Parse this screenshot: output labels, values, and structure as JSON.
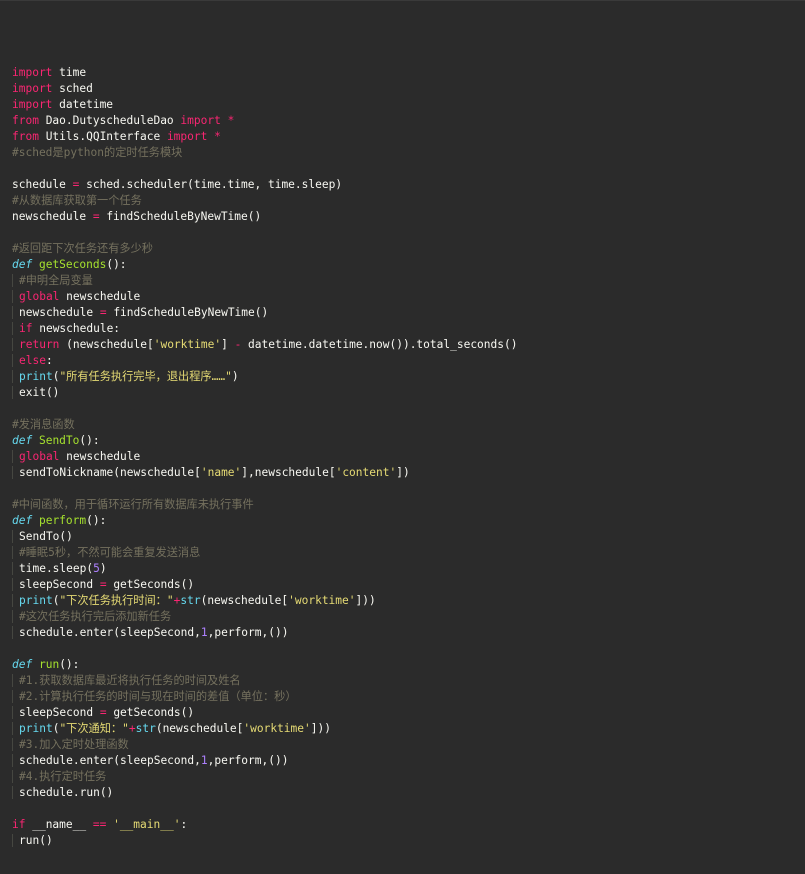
{
  "theme": {
    "background": "#2b2b2b",
    "keyword": "#f92672",
    "def_keyword": "#66d9ef",
    "function_name": "#a6e22e",
    "string": "#e6db74",
    "number": "#ae81ff",
    "comment": "#75715e",
    "text": "#f8f8f2"
  },
  "lines": [
    {
      "indent": false,
      "tokens": [
        {
          "t": "kw",
          "v": "import"
        },
        {
          "t": "txt",
          "v": " time"
        }
      ]
    },
    {
      "indent": false,
      "tokens": [
        {
          "t": "kw",
          "v": "import"
        },
        {
          "t": "txt",
          "v": " sched"
        }
      ]
    },
    {
      "indent": false,
      "tokens": [
        {
          "t": "kw",
          "v": "import"
        },
        {
          "t": "txt",
          "v": " datetime"
        }
      ]
    },
    {
      "indent": false,
      "tokens": [
        {
          "t": "kw",
          "v": "from"
        },
        {
          "t": "txt",
          "v": " Dao.DutyscheduleDao "
        },
        {
          "t": "kw",
          "v": "import"
        },
        {
          "t": "op",
          "v": " *"
        }
      ]
    },
    {
      "indent": false,
      "tokens": [
        {
          "t": "kw",
          "v": "from"
        },
        {
          "t": "txt",
          "v": " Utils.QQInterface "
        },
        {
          "t": "kw",
          "v": "import"
        },
        {
          "t": "op",
          "v": " *"
        }
      ]
    },
    {
      "indent": false,
      "tokens": [
        {
          "t": "cmt",
          "v": "#sched是python的定时任务模块"
        }
      ]
    },
    {
      "indent": false,
      "tokens": []
    },
    {
      "indent": false,
      "tokens": [
        {
          "t": "txt",
          "v": "schedule "
        },
        {
          "t": "op",
          "v": "="
        },
        {
          "t": "txt",
          "v": " sched.scheduler(time.time, time.sleep)"
        }
      ]
    },
    {
      "indent": false,
      "tokens": [
        {
          "t": "cmt",
          "v": "#从数据库获取第一个任务"
        }
      ]
    },
    {
      "indent": false,
      "tokens": [
        {
          "t": "txt",
          "v": "newschedule "
        },
        {
          "t": "op",
          "v": "="
        },
        {
          "t": "txt",
          "v": " findScheduleByNewTime()"
        }
      ]
    },
    {
      "indent": false,
      "tokens": []
    },
    {
      "indent": false,
      "tokens": [
        {
          "t": "cmt",
          "v": "#返回距下次任务还有多少秒"
        }
      ]
    },
    {
      "indent": false,
      "tokens": [
        {
          "t": "def",
          "v": "def"
        },
        {
          "t": "txt",
          "v": " "
        },
        {
          "t": "fn",
          "v": "getSeconds"
        },
        {
          "t": "txt",
          "v": "():"
        }
      ]
    },
    {
      "indent": true,
      "tokens": [
        {
          "t": "cmt",
          "v": "#申明全局变量"
        }
      ]
    },
    {
      "indent": true,
      "tokens": [
        {
          "t": "kw",
          "v": "global"
        },
        {
          "t": "txt",
          "v": " newschedule"
        }
      ]
    },
    {
      "indent": true,
      "tokens": [
        {
          "t": "txt",
          "v": "newschedule "
        },
        {
          "t": "op",
          "v": "="
        },
        {
          "t": "txt",
          "v": " findScheduleByNewTime()"
        }
      ]
    },
    {
      "indent": true,
      "tokens": [
        {
          "t": "kw",
          "v": "if"
        },
        {
          "t": "txt",
          "v": " newschedule:"
        }
      ]
    },
    {
      "indent": true,
      "tokens": [
        {
          "t": "kw",
          "v": "return"
        },
        {
          "t": "txt",
          "v": " (newschedule["
        },
        {
          "t": "str",
          "v": "'worktime'"
        },
        {
          "t": "txt",
          "v": "] "
        },
        {
          "t": "op",
          "v": "-"
        },
        {
          "t": "txt",
          "v": " datetime.datetime.now()).total_seconds()"
        }
      ]
    },
    {
      "indent": true,
      "tokens": [
        {
          "t": "kw",
          "v": "else"
        },
        {
          "t": "txt",
          "v": ":"
        }
      ]
    },
    {
      "indent": true,
      "tokens": [
        {
          "t": "bi",
          "v": "print"
        },
        {
          "t": "txt",
          "v": "("
        },
        {
          "t": "str",
          "v": "\"所有任务执行完毕，退出程序……\""
        },
        {
          "t": "txt",
          "v": ")"
        }
      ]
    },
    {
      "indent": true,
      "tokens": [
        {
          "t": "txt",
          "v": "exit()"
        }
      ]
    },
    {
      "indent": false,
      "tokens": []
    },
    {
      "indent": false,
      "tokens": [
        {
          "t": "cmt",
          "v": "#发消息函数"
        }
      ]
    },
    {
      "indent": false,
      "tokens": [
        {
          "t": "def",
          "v": "def"
        },
        {
          "t": "txt",
          "v": " "
        },
        {
          "t": "fn",
          "v": "SendTo"
        },
        {
          "t": "txt",
          "v": "():"
        }
      ]
    },
    {
      "indent": true,
      "tokens": [
        {
          "t": "kw",
          "v": "global"
        },
        {
          "t": "txt",
          "v": " newschedule"
        }
      ]
    },
    {
      "indent": true,
      "tokens": [
        {
          "t": "txt",
          "v": "sendToNickname(newschedule["
        },
        {
          "t": "str",
          "v": "'name'"
        },
        {
          "t": "txt",
          "v": "],newschedule["
        },
        {
          "t": "str",
          "v": "'content'"
        },
        {
          "t": "txt",
          "v": "])"
        }
      ]
    },
    {
      "indent": false,
      "tokens": []
    },
    {
      "indent": false,
      "tokens": [
        {
          "t": "cmt",
          "v": "#中间函数，用于循环运行所有数据库未执行事件"
        }
      ]
    },
    {
      "indent": false,
      "tokens": [
        {
          "t": "def",
          "v": "def"
        },
        {
          "t": "txt",
          "v": " "
        },
        {
          "t": "fn",
          "v": "perform"
        },
        {
          "t": "txt",
          "v": "():"
        }
      ]
    },
    {
      "indent": true,
      "tokens": [
        {
          "t": "txt",
          "v": "SendTo()"
        }
      ]
    },
    {
      "indent": true,
      "tokens": [
        {
          "t": "cmt",
          "v": "#睡眠5秒，不然可能会重复发送消息"
        }
      ]
    },
    {
      "indent": true,
      "tokens": [
        {
          "t": "txt",
          "v": "time.sleep("
        },
        {
          "t": "num",
          "v": "5"
        },
        {
          "t": "txt",
          "v": ")"
        }
      ]
    },
    {
      "indent": true,
      "tokens": [
        {
          "t": "txt",
          "v": "sleepSecond "
        },
        {
          "t": "op",
          "v": "="
        },
        {
          "t": "txt",
          "v": " getSeconds()"
        }
      ]
    },
    {
      "indent": true,
      "tokens": [
        {
          "t": "bi",
          "v": "print"
        },
        {
          "t": "txt",
          "v": "("
        },
        {
          "t": "str",
          "v": "\"下次任务执行时间：\""
        },
        {
          "t": "op",
          "v": "+"
        },
        {
          "t": "bi",
          "v": "str"
        },
        {
          "t": "txt",
          "v": "(newschedule["
        },
        {
          "t": "str",
          "v": "'worktime'"
        },
        {
          "t": "txt",
          "v": "]))"
        }
      ]
    },
    {
      "indent": true,
      "tokens": [
        {
          "t": "cmt",
          "v": "#这次任务执行完后添加新任务"
        }
      ]
    },
    {
      "indent": true,
      "tokens": [
        {
          "t": "txt",
          "v": "schedule.enter(sleepSecond,"
        },
        {
          "t": "num",
          "v": "1"
        },
        {
          "t": "txt",
          "v": ",perform,())"
        }
      ]
    },
    {
      "indent": false,
      "tokens": []
    },
    {
      "indent": false,
      "tokens": [
        {
          "t": "def",
          "v": "def"
        },
        {
          "t": "txt",
          "v": " "
        },
        {
          "t": "fn",
          "v": "run"
        },
        {
          "t": "txt",
          "v": "():"
        }
      ]
    },
    {
      "indent": true,
      "tokens": [
        {
          "t": "cmt",
          "v": "#1.获取数据库最近将执行任务的时间及姓名"
        }
      ]
    },
    {
      "indent": true,
      "tokens": [
        {
          "t": "cmt",
          "v": "#2.计算执行任务的时间与现在时间的差值（单位：秒）"
        }
      ]
    },
    {
      "indent": true,
      "tokens": [
        {
          "t": "txt",
          "v": "sleepSecond "
        },
        {
          "t": "op",
          "v": "="
        },
        {
          "t": "txt",
          "v": " getSeconds()"
        }
      ]
    },
    {
      "indent": true,
      "tokens": [
        {
          "t": "bi",
          "v": "print"
        },
        {
          "t": "txt",
          "v": "("
        },
        {
          "t": "str",
          "v": "\"下次通知：\""
        },
        {
          "t": "op",
          "v": "+"
        },
        {
          "t": "bi",
          "v": "str"
        },
        {
          "t": "txt",
          "v": "(newschedule["
        },
        {
          "t": "str",
          "v": "'worktime'"
        },
        {
          "t": "txt",
          "v": "]))"
        }
      ]
    },
    {
      "indent": true,
      "tokens": [
        {
          "t": "cmt",
          "v": "#3.加入定时处理函数"
        }
      ]
    },
    {
      "indent": true,
      "tokens": [
        {
          "t": "txt",
          "v": "schedule.enter(sleepSecond,"
        },
        {
          "t": "num",
          "v": "1"
        },
        {
          "t": "txt",
          "v": ",perform,())"
        }
      ]
    },
    {
      "indent": true,
      "tokens": [
        {
          "t": "cmt",
          "v": "#4.执行定时任务"
        }
      ]
    },
    {
      "indent": true,
      "tokens": [
        {
          "t": "txt",
          "v": "schedule.run()"
        }
      ]
    },
    {
      "indent": false,
      "tokens": []
    },
    {
      "indent": false,
      "tokens": [
        {
          "t": "kw",
          "v": "if"
        },
        {
          "t": "txt",
          "v": " __name__ "
        },
        {
          "t": "op",
          "v": "=="
        },
        {
          "t": "txt",
          "v": " "
        },
        {
          "t": "str",
          "v": "'__main__'"
        },
        {
          "t": "txt",
          "v": ":"
        }
      ]
    },
    {
      "indent": true,
      "tokens": [
        {
          "t": "txt",
          "v": "run()"
        }
      ]
    }
  ]
}
